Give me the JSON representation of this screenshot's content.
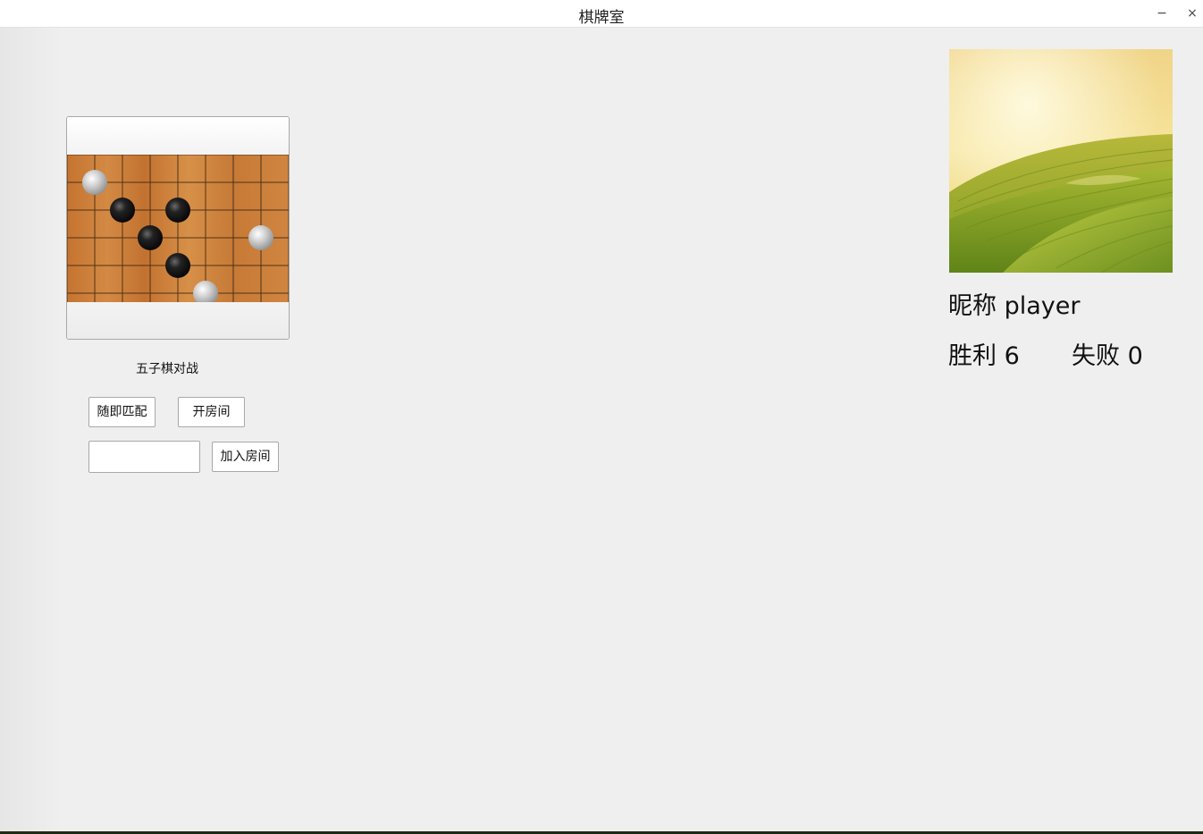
{
  "window": {
    "title": "棋牌室",
    "minimize_symbol": "−",
    "close_symbol": "×"
  },
  "lobby": {
    "game_label": "五子棋对战",
    "random_match_label": "随即匹配",
    "open_room_label": "开房间",
    "room_input_value": "",
    "room_input_placeholder": "",
    "join_room_label": "加入房间"
  },
  "board_preview": {
    "stones": [
      {
        "col": 1,
        "row": 1,
        "color": "white"
      },
      {
        "col": 2,
        "row": 2,
        "color": "black"
      },
      {
        "col": 4,
        "row": 2,
        "color": "black"
      },
      {
        "col": 3,
        "row": 3,
        "color": "black"
      },
      {
        "col": 7,
        "row": 3,
        "color": "white"
      },
      {
        "col": 4,
        "row": 4,
        "color": "black"
      },
      {
        "col": 5,
        "row": 5,
        "color": "white"
      }
    ]
  },
  "profile": {
    "avatar_icon": "landscape-image",
    "nickname_text": "昵称 player",
    "wins_text": "胜利 6",
    "losses_text": "失败 0"
  },
  "colors": {
    "board_wood": "#c8782e",
    "window_bg": "#efefef",
    "titlebar_bg": "#ffffff"
  }
}
